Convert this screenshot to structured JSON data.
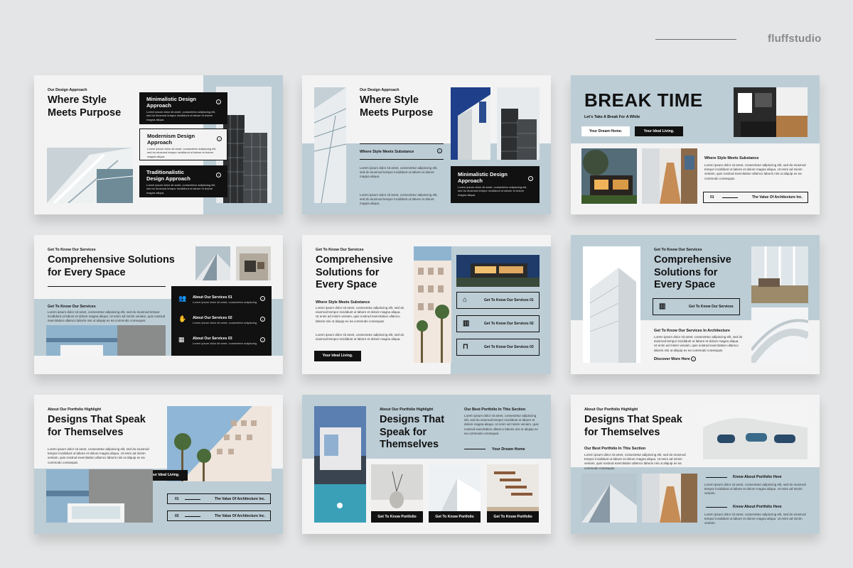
{
  "brand": {
    "name": "fluffstudio"
  },
  "common": {
    "lorem_a": "Lorem ipsum dolor sit amet, consectetur adipiscing elit, sed do eiusmod tempor incididunt ut labore et dolore magna aliqua. Ut enim ad minim veniam, quis nostrud exercitation ullamco laboris nisi ut aliquip ex ea commodo consequat.",
    "lorem_short": "Lorem ipsum dolor sit amet, consectetur adipiscing elit, sed do eiusmod tempor incididunt ut labore et dolore magna aliqua. Ut enim ad minim veniam.",
    "lorem_card": "Lorem ipsum dolor sit amet, consectetur adipiscing elit, sed do eiusmod tempor incididunt ut labore et dolore magna aliqua."
  },
  "s1": {
    "kicker": "Our Design Approach",
    "title": "Where Style Meets Purpose",
    "cards": [
      {
        "title": "Minimalistic Design Approach"
      },
      {
        "title": "Modernism Design Approach"
      },
      {
        "title": "Traditionalistic Design Approach"
      }
    ]
  },
  "s2": {
    "kicker": "Our Design Approach",
    "title": "Where Style Meets Purpose",
    "row": "Where Style Meets Substance",
    "card": "Minimalistic Design Approach"
  },
  "s3": {
    "title": "BREAK TIME",
    "tagline": "Let's Take A Break For A While",
    "btn1": "Your Dream Home.",
    "btn2": "Your Ideal Living.",
    "sub": "Where Style Meets Substance",
    "num": "01",
    "box": "The Value Of Architecture Inc."
  },
  "s4": {
    "kicker": "Get To Know Our Services",
    "title": "Comprehensive Solutions for Every Space",
    "sub": "Get To Know Our Services",
    "services": [
      "About Our Services 01",
      "About Our Services 02",
      "About Our Services 03"
    ],
    "service_text": "Lorem ipsum dolor sit amet, consectetur adipiscing"
  },
  "s5": {
    "kicker": "Get To Know Our Services",
    "title": "Comprehensive Solutions for Every Space",
    "sub": "Where Style Meets Substance",
    "btn": "Your Ideal Living.",
    "rows": [
      "Get To Know Our Services 01",
      "Get To Know Our Services 02",
      "Get To Know Our Services 03"
    ]
  },
  "s6": {
    "kicker": "Get To Know Our Services",
    "title": "Comprehensive Solutions for Every Space",
    "box": "Get To Know Our Services",
    "sub": "Get To Know Our Services In Architecture",
    "link": "Discover More Here"
  },
  "s7": {
    "kicker": "About Our Portfolio Highlight",
    "title": "Designs That Speak for Themselves",
    "btn": "Your Ideal Living.",
    "rows": [
      {
        "num": "01",
        "label": "The Value Of Architecture Inc."
      },
      {
        "num": "02",
        "label": "The Value Of Architecture Inc."
      }
    ]
  },
  "s8": {
    "kicker": "About Our Portfolio Highlight",
    "title": "Designs That Speak for Themselves",
    "sub": "Our Best Portfolio In This Section",
    "tag": "Your Dream Home",
    "buttons": [
      "Get To Know Portfolio",
      "Get To Know Portfolio",
      "Get To Know Portfolio"
    ]
  },
  "s9": {
    "kicker": "About Our Portfolio Highlight",
    "title": "Designs That Speak for Themselves",
    "sub": "Our Best Portfolio In This Section",
    "know1": "Know About Portfolio Here",
    "know2": "Know About Portfolio Here"
  }
}
